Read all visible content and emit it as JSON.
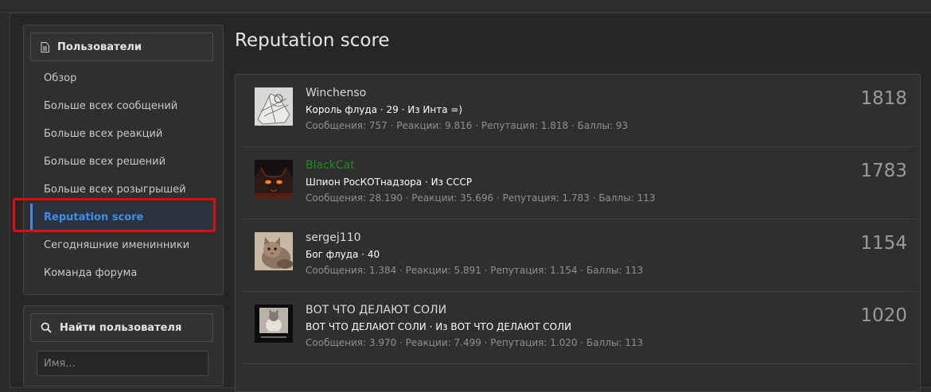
{
  "sidebar": {
    "users_heading": "Пользователи",
    "items": [
      {
        "label": "Обзор"
      },
      {
        "label": "Больше всех сообщений"
      },
      {
        "label": "Больше всех реакций"
      },
      {
        "label": "Больше всех решений"
      },
      {
        "label": "Больше всех розыгрышей"
      },
      {
        "label": "Reputation score",
        "active": true
      },
      {
        "label": "Сегодняшние именинники"
      },
      {
        "label": "Команда форума"
      }
    ],
    "find_heading": "Найти пользователя",
    "find_placeholder": "Имя..."
  },
  "main": {
    "title": "Reputation score",
    "users": [
      {
        "name": "Winchenso",
        "title": "Король флуда · 29 · Из Инта =)",
        "stats": "Сообщения: 757 · Реакции: 9.816 · Репутация: 1.818 · Баллы: 93",
        "score": "1818",
        "name_color": "#dadada"
      },
      {
        "name": "BlackCat",
        "title": "Шпион РосКОТнадзора · Из СССР",
        "stats": "Сообщения: 28.190 · Реакции: 35.696 · Репутация: 1.783 · Баллы: 113",
        "score": "1783",
        "name_color": "#1e8c1e"
      },
      {
        "name": "sergej110",
        "title": "Бог флуда · 40",
        "stats": "Сообщения: 1.384 · Реакции: 5.891 · Репутация: 1.154 · Баллы: 113",
        "score": "1154",
        "name_color": "#dadada"
      },
      {
        "name": "ВОТ ЧТО ДЕЛАЮТ СОЛИ",
        "title": "ВОТ ЧТО ДЕЛАЮТ СОЛИ · Из ВОТ ЧТО ДЕЛАЮТ СОЛИ",
        "stats": "Сообщения: 3.970 · Реакции: 7.499 · Репутация: 1.020 · Баллы: 113",
        "score": "1020",
        "name_color": "#dadada"
      }
    ]
  },
  "colors": {
    "accent": "#3f8ee6",
    "highlight_border": "#e00c0c",
    "background": "#2b2b2b"
  },
  "icons": {
    "users_heading": "document-icon",
    "find_heading": "search-icon"
  }
}
